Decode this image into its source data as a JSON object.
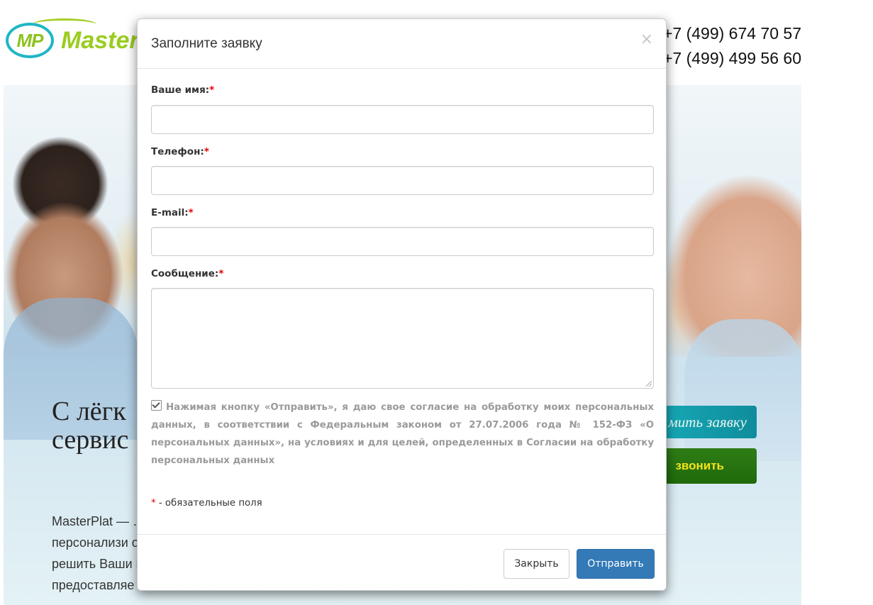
{
  "brand": {
    "logo_mark": "MP",
    "logo_text": "Master"
  },
  "header": {
    "phone_1": "+7 (499) 674 70 57",
    "phone_2": "+7 (499) 499 56 60"
  },
  "hero": {
    "title_line_1": "С лёгк",
    "title_line_2": "сервис",
    "order_button": "мить заявку",
    "call_button": "звонить",
    "text_lines": [
      "MasterPlat — …                                                                                                                         иповые и",
      "персонализи                                                                                                                     огут успешно",
      "решить Ваши                                                                                                                        ы также",
      "предоставляе"
    ]
  },
  "modal": {
    "title": "Заполните заявку",
    "close_icon": "×",
    "fields": {
      "name_label": "Ваше имя:",
      "phone_label": "Телефон:",
      "email_label": "E-mail:",
      "message_label": "Сообщение:",
      "required_mark": "*"
    },
    "consent_text": "Нажимая кнопку «Отправить», я даю свое согласие на обработку моих персональных данных, в соответствии с Федеральным законом от 27.07.2006 года № 152-ФЗ «О персональных данных», на условиях и для целей, определенных в Согласии на обработку персональных данных",
    "consent_checked": true,
    "required_note_mark": "*",
    "required_note_text": " - обязательные поля",
    "close_button": "Закрыть",
    "send_button": "Отправить"
  },
  "colors": {
    "primary_button": "#337ab7",
    "required": "#e00000",
    "logo_green": "#9acd1f",
    "logo_teal": "#1fb6c4"
  }
}
